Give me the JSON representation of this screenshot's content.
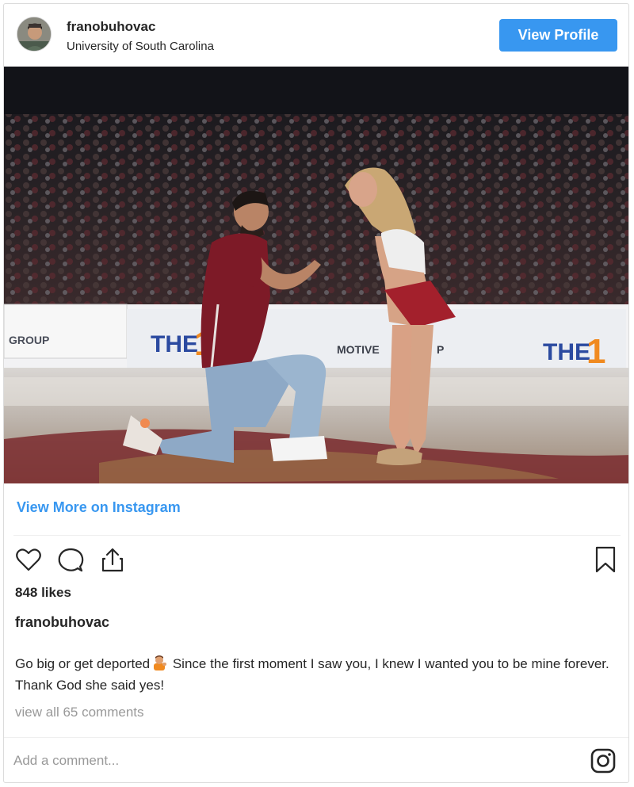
{
  "post": {
    "username": "franobuhovac",
    "location": "University of South Carolina",
    "view_profile_label": "View Profile",
    "view_more_label": "View More on Instagram",
    "likes": "848 likes",
    "caption_user": "franobuhovac",
    "caption_before_emoji": "Go big or get deported",
    "caption_after_emoji": " Since the first moment I saw you, I knew I wanted you to be mine forever. Thank God she said yes!",
    "view_comments": "view all 65 comments",
    "comment_placeholder": "Add a comment..."
  },
  "photo": {
    "banner_left_text": "GROUP",
    "banner_mid_text": "MOTIVE",
    "banner_mid_tail": "P",
    "banner_logo_text": "THE",
    "banner_logo_digit": "1"
  },
  "icons": {
    "like": "heart-icon",
    "comment": "comment-bubble-icon",
    "share": "share-icon",
    "save": "bookmark-icon",
    "instagram": "instagram-glyph-icon",
    "emoji": "person-gesturing-emoji"
  },
  "colors": {
    "accent_blue": "#3897f0",
    "text": "#262626",
    "muted": "#999999",
    "border": "#dbdbdb",
    "maroon": "#8a1c2b"
  }
}
